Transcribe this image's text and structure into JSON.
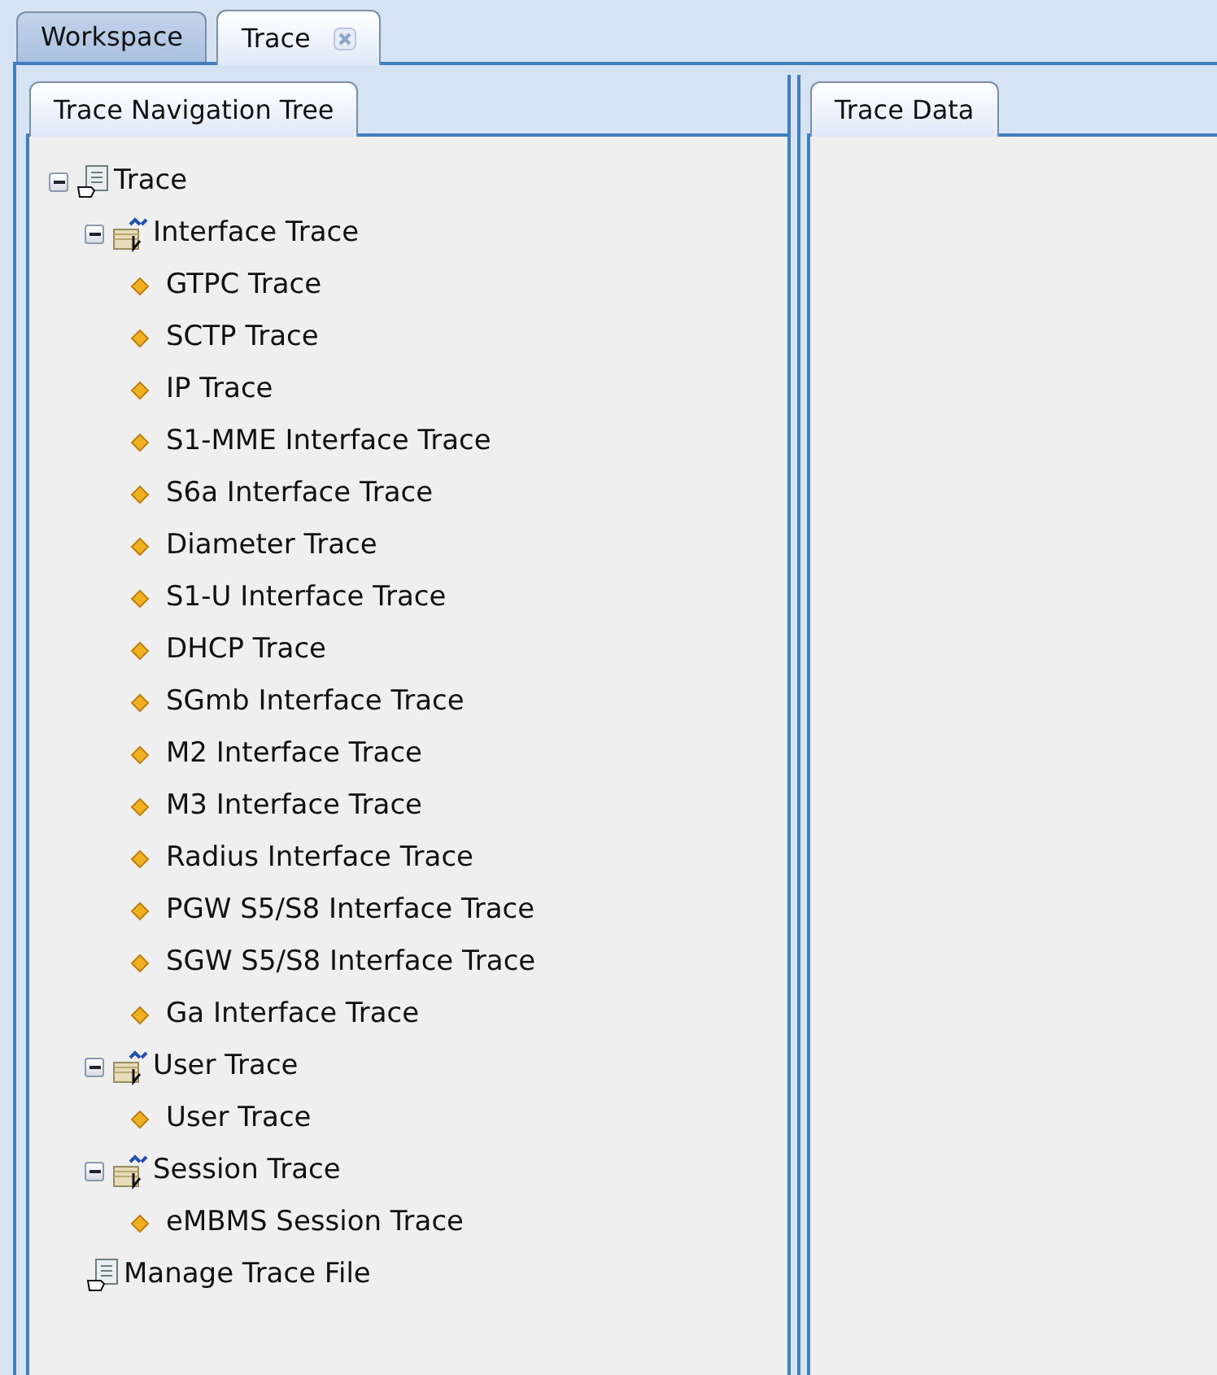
{
  "top_tabs": [
    {
      "label": "Workspace",
      "selected": false,
      "closable": false
    },
    {
      "label": "Trace",
      "selected": true,
      "closable": true
    }
  ],
  "left_panel": {
    "tabs": [
      {
        "label": "Trace Navigation Tree",
        "selected": true
      }
    ],
    "tree": [
      {
        "label": "Trace",
        "kind": "document",
        "expanded": true,
        "children": [
          {
            "label": "Interface Trace",
            "kind": "folder",
            "expanded": true,
            "children": [
              {
                "label": "GTPC Trace",
                "kind": "item"
              },
              {
                "label": "SCTP Trace",
                "kind": "item"
              },
              {
                "label": "IP Trace",
                "kind": "item"
              },
              {
                "label": "S1-MME Interface Trace",
                "kind": "item"
              },
              {
                "label": "S6a Interface Trace",
                "kind": "item"
              },
              {
                "label": "Diameter Trace",
                "kind": "item"
              },
              {
                "label": "S1-U Interface Trace",
                "kind": "item"
              },
              {
                "label": "DHCP Trace",
                "kind": "item"
              },
              {
                "label": "SGmb Interface Trace",
                "kind": "item"
              },
              {
                "label": "M2 Interface Trace",
                "kind": "item"
              },
              {
                "label": "M3 Interface Trace",
                "kind": "item"
              },
              {
                "label": "Radius Interface Trace",
                "kind": "item"
              },
              {
                "label": "PGW S5/S8 Interface Trace",
                "kind": "item"
              },
              {
                "label": "SGW S5/S8 Interface Trace",
                "kind": "item"
              },
              {
                "label": "Ga Interface Trace",
                "kind": "item"
              }
            ]
          },
          {
            "label": "User Trace",
            "kind": "folder",
            "expanded": true,
            "children": [
              {
                "label": "User Trace",
                "kind": "item"
              }
            ]
          },
          {
            "label": "Session Trace",
            "kind": "folder",
            "expanded": true,
            "children": [
              {
                "label": "eMBMS Session Trace",
                "kind": "item"
              }
            ]
          },
          {
            "label": "Manage Trace File",
            "kind": "document"
          }
        ]
      }
    ]
  },
  "right_panel": {
    "tabs": [
      {
        "label": "Trace Data",
        "selected": true
      }
    ]
  }
}
